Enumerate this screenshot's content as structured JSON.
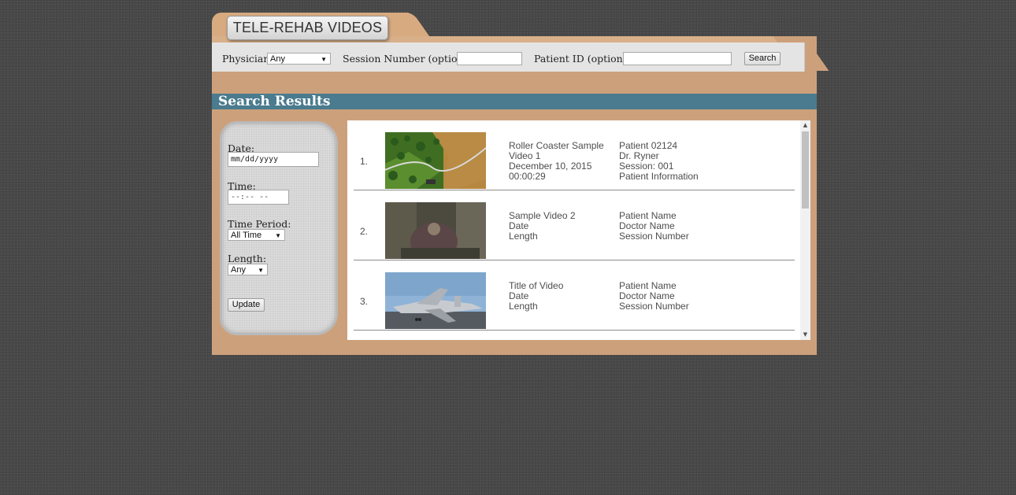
{
  "header": {
    "title": "TELE-REHAB VIDEOS"
  },
  "search": {
    "physician_label": "Physician:",
    "physician_value": "Any",
    "session_label": "Session Number (optional):",
    "session_value": "",
    "patient_label": "Patient ID (optional):",
    "patient_value": "",
    "search_button": "Search"
  },
  "results_title": "Search Results",
  "filters": {
    "date_label": "Date:",
    "date_value": "mm/dd/yyyy",
    "time_label": "Time:",
    "time_value": "--:-- --",
    "period_label": "Time Period:",
    "period_value": "All Time",
    "length_label": "Length:",
    "length_value": "Any",
    "update_button": "Update"
  },
  "results": [
    {
      "number": "1.",
      "thumb": "roller-coaster",
      "info": [
        "Roller Coaster Sample",
        "Video 1",
        "December 10, 2015",
        "00:00:29"
      ],
      "meta": [
        "Patient 02124",
        "Dr. Ryner",
        "Session: 001",
        "Patient Information"
      ]
    },
    {
      "number": "2.",
      "thumb": "dark-scene",
      "info": [
        "Sample Video 2",
        "Date",
        "Length"
      ],
      "meta": [
        "Patient Name",
        "Doctor Name",
        "Session Number"
      ]
    },
    {
      "number": "3.",
      "thumb": "jet-aircraft",
      "info": [
        "Title of Video",
        "Date",
        "Length"
      ],
      "meta": [
        "Patient Name",
        "Doctor Name",
        "Session Number"
      ]
    }
  ],
  "colors": {
    "background": "#4a4a4a",
    "folder": "#cda07c",
    "results_header": "#4a7b8e",
    "search_bar": "#e4e4e4"
  }
}
